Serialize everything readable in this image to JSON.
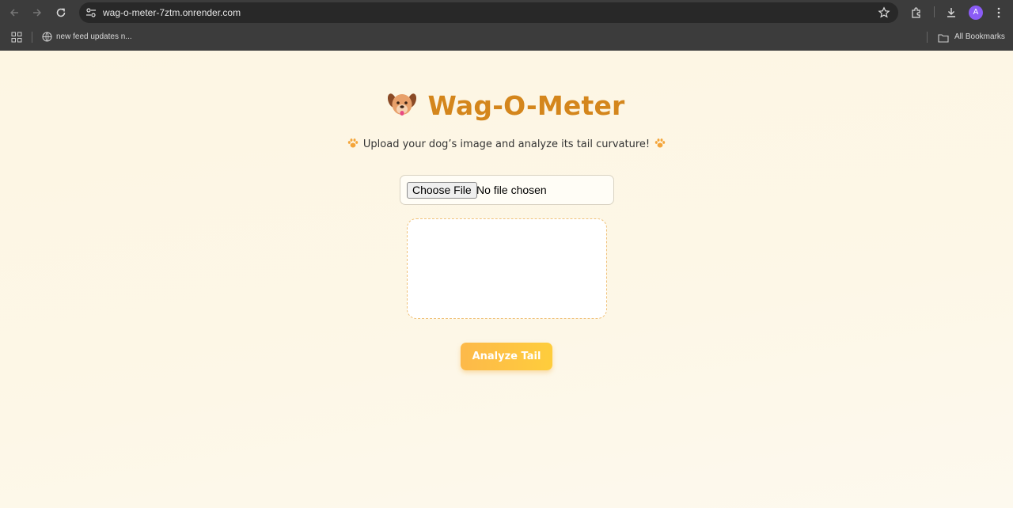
{
  "browser": {
    "url": "wag-o-meter-7ztm.onrender.com",
    "bookmark_item": "new feed updates n...",
    "all_bookmarks": "All Bookmarks",
    "avatar_letter": "A"
  },
  "page": {
    "title": "Wag-O-Meter",
    "subtitle": "Upload your dog’s image and analyze its tail curvature!",
    "file_button": "Choose File",
    "file_status": "No file chosen",
    "analyze_button": "Analyze Tail"
  },
  "colors": {
    "title": "#d4861c",
    "button_start": "#fdb94a",
    "button_end": "#fecd3c",
    "preview_border": "#f0c27a"
  },
  "icons": {
    "header": "dog-face-icon",
    "subtitle": "paw-prints-icon"
  }
}
